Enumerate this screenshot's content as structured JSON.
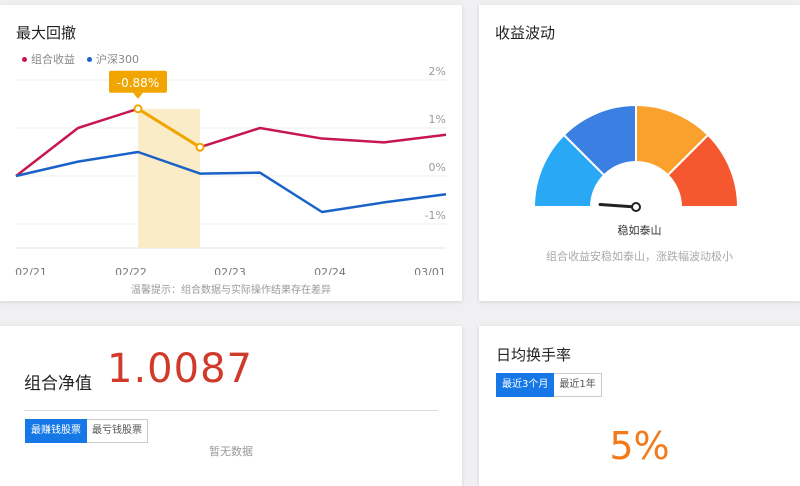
{
  "drawdown": {
    "title": "最大回撤",
    "legend": [
      {
        "name": "组合收益",
        "color": "#c8174e"
      },
      {
        "name": "沪深300",
        "color": "#1a62c8"
      }
    ],
    "tooltip": "-0.88%",
    "hint": "温馨提示：组合数据与实际操作结果存在差异",
    "chart_data": {
      "type": "line",
      "x": [
        "02/21",
        "02/22",
        "02/23",
        "02/24",
        "03/01"
      ],
      "x_positions": [
        0,
        0.65,
        1.3,
        1.95,
        2.6,
        3.25,
        3.9,
        4.55,
        5.2,
        5.85,
        6.5
      ],
      "yticks": [
        "2%",
        "1%",
        "0%",
        "-1%"
      ],
      "ylim": [
        -1.5,
        2.0
      ],
      "series": [
        {
          "name": "组合收益",
          "color": "#c8174e",
          "values": [
            0.0,
            1.0,
            1.4,
            0.6,
            1.0,
            0.78,
            0.7,
            0.86
          ]
        },
        {
          "name": "沪深300",
          "color": "#1a62c8",
          "values": [
            0.0,
            0.3,
            0.5,
            0.05,
            0.07,
            -0.75,
            -0.55,
            -0.38
          ]
        }
      ],
      "series_x_index": [
        0,
        1,
        2,
        3,
        4,
        5,
        6,
        7
      ],
      "highlight": {
        "from_index": 2,
        "to_index": 3,
        "color": "#f0a500",
        "fill": "#fbecc8"
      }
    }
  },
  "volatility": {
    "title": "收益波动",
    "gauge": {
      "segments": [
        "#29a8f5",
        "#3b7fe3",
        "#f9a12c",
        "#f5582e"
      ],
      "value": 0.07
    },
    "label": "稳如泰山",
    "desc": "组合收益安稳如泰山，涨跌幅波动极小"
  },
  "nav": {
    "label": "组合净值",
    "value": "1.0087",
    "tabs": [
      "最赚钱股票",
      "最亏钱股票"
    ],
    "empty": "暂无数据"
  },
  "turnover": {
    "title": "日均换手率",
    "tabs": [
      "最近3个月",
      "最近1年"
    ],
    "value": "5%"
  }
}
